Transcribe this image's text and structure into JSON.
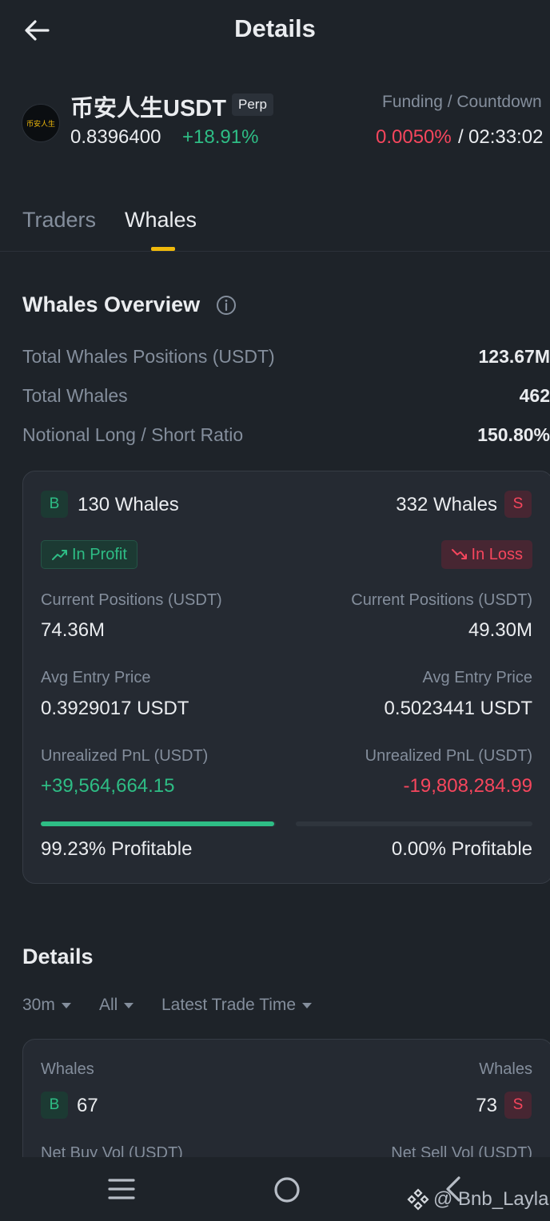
{
  "header": {
    "title": "Details"
  },
  "token": {
    "logo_text": "币安人生",
    "symbol": "币安人生USDT",
    "badge": "Perp",
    "price": "0.8396400",
    "change": "+18.91%",
    "funding_label": "Funding / Countdown",
    "funding_rate": "0.0050%",
    "separator": "/",
    "countdown": "02:33:02"
  },
  "tabs": [
    {
      "label": "Traders",
      "active": false
    },
    {
      "label": "Whales",
      "active": true
    }
  ],
  "overview": {
    "title": "Whales Overview",
    "rows": [
      {
        "label": "Total Whales Positions (USDT)",
        "value": "123.67M"
      },
      {
        "label": "Total Whales",
        "value": "462"
      },
      {
        "label": "Notional Long / Short Ratio",
        "value": "150.80%"
      }
    ]
  },
  "summary": {
    "long": {
      "badge": "B",
      "count": "130 Whales",
      "status": "In Profit",
      "positions_label": "Current Positions (USDT)",
      "positions": "74.36M",
      "entry_label": "Avg Entry Price",
      "entry": "0.3929017 USDT",
      "pnl_label": "Unrealized PnL (USDT)",
      "pnl": "+39,564,664.15",
      "profitable_fraction": 0.9923,
      "profitable_text": "99.23% Profitable"
    },
    "short": {
      "badge": "S",
      "count": "332 Whales",
      "status": "In Loss",
      "positions_label": "Current Positions (USDT)",
      "positions": "49.30M",
      "entry_label": "Avg Entry Price",
      "entry": "0.5023441 USDT",
      "pnl_label": "Unrealized PnL (USDT)",
      "pnl": "-19,808,284.99",
      "profitable_fraction": 0.0,
      "profitable_text": "0.00% Profitable"
    }
  },
  "details": {
    "title": "Details",
    "filters": [
      "30m",
      "All",
      "Latest Trade Time"
    ],
    "whales_label_left": "Whales",
    "whales_label_right": "Whales",
    "buy_badge": "B",
    "buy_count": "67",
    "sell_badge": "S",
    "sell_count": "73",
    "net_buy_label": "Net Buy Vol (USDT)",
    "net_sell_label": "Net Sell Vol (USDT)"
  },
  "watermark": "@ Bnb_Layla",
  "colors": {
    "green": "#2ebd85",
    "red": "#f6465d",
    "accent": "#f0b90b",
    "background": "#1e2329"
  }
}
